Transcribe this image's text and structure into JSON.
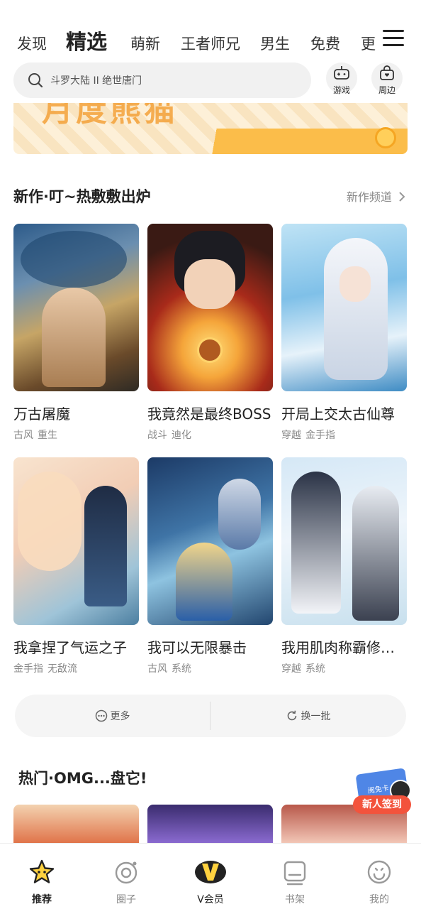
{
  "top_tabs": {
    "items": [
      "发现",
      "精选",
      "萌新",
      "王者师兄",
      "男生",
      "免费",
      "更"
    ],
    "active_index": 1
  },
  "search": {
    "placeholder": "斗罗大陆 II 绝世唐门"
  },
  "quick_links": [
    {
      "label": "游戏",
      "icon": "gamepad-icon"
    },
    {
      "label": "周边",
      "icon": "shopping-bag-icon"
    }
  ],
  "section_new": {
    "title": "新作·叮~热敷敷出炉",
    "link": "新作频道"
  },
  "comics": [
    {
      "title": "万古屠魔",
      "tags": [
        "古风",
        "重生"
      ]
    },
    {
      "title": "我竟然是最终BOSS",
      "tags": [
        "战斗",
        "迪化"
      ]
    },
    {
      "title": "开局上交太古仙尊",
      "tags": [
        "穿越",
        "金手指"
      ]
    },
    {
      "title": "我拿捏了气运之子",
      "tags": [
        "金手指",
        "无敌流"
      ]
    },
    {
      "title": "我可以无限暴击",
      "tags": [
        "古风",
        "系统"
      ]
    },
    {
      "title": "我用肌肉称霸修仙界",
      "tags": [
        "穿越",
        "系统"
      ]
    }
  ],
  "actions": {
    "more": "更多",
    "refresh": "换一批"
  },
  "section_hot": {
    "title": "热门·OMG...盘它!"
  },
  "float_badge": {
    "card_text": "阅免卡",
    "label": "新人签到"
  },
  "bottom_nav": [
    {
      "label": "推荐",
      "icon": "star-icon",
      "active": true
    },
    {
      "label": "圈子",
      "icon": "circle-icon",
      "active": false
    },
    {
      "label": "V会员",
      "icon": "vip-icon",
      "active": false
    },
    {
      "label": "书架",
      "icon": "bookshelf-icon",
      "active": false
    },
    {
      "label": "我的",
      "icon": "profile-icon",
      "active": false
    }
  ],
  "colors": {
    "accent": "#ffd23f",
    "badge_red": "#f3533c",
    "badge_blue": "#4f86e6"
  }
}
